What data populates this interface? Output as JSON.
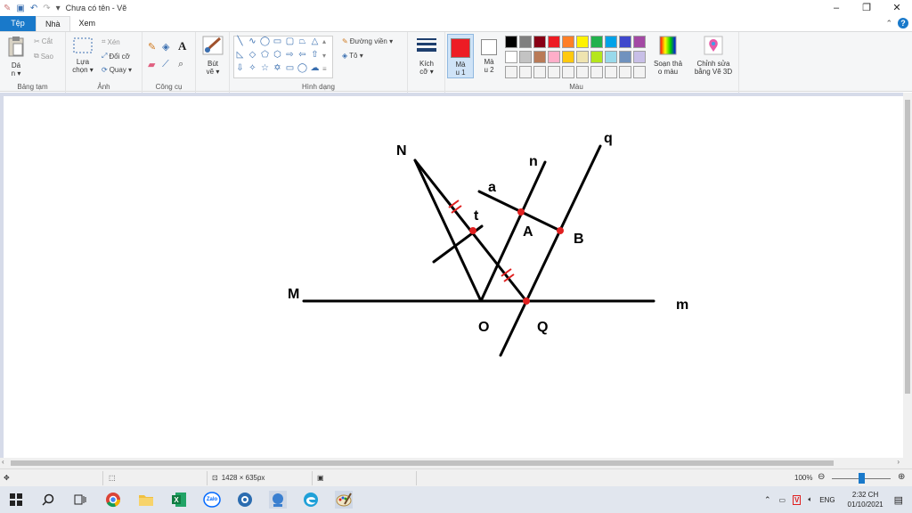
{
  "window": {
    "title": "Chưa có tên - Vẽ",
    "controls": {
      "minimize": "–",
      "maximize": "❐",
      "close": "✕"
    }
  },
  "tabs": {
    "file": "Tệp",
    "home": "Nhà",
    "view": "Xem",
    "help": "?"
  },
  "ribbon": {
    "clipboard": {
      "label": "Bảng tạm",
      "paste": "Dá",
      "paste2": "n ▾",
      "cut": "Cắt",
      "copy": "Sao"
    },
    "image": {
      "label": "Ảnh",
      "select": "Lựa",
      "select2": "chọn ▾",
      "crop": "Xén",
      "resize": "Đổi cỡ",
      "rotate": "Quay ▾"
    },
    "tools": {
      "label": "Công cụ",
      "text_glyph": "A"
    },
    "brushes": {
      "label": "Bút",
      "label2": "vẽ ▾"
    },
    "shapes": {
      "label": "Hình dạng",
      "outline": "Đường viền ▾",
      "fill": "Tô ▾"
    },
    "size": {
      "label": "Kích",
      "label2": "cỡ ▾"
    },
    "color1": {
      "label": "Mà",
      "label2": "u 1",
      "color": "#ed1c24"
    },
    "color2": {
      "label": "Mà",
      "label2": "u 2",
      "color": "#ffffff"
    },
    "colors": {
      "label": "Màu",
      "row1": [
        "#000000",
        "#7f7f7f",
        "#880015",
        "#ed1c24",
        "#ff7f27",
        "#fff200",
        "#22b14c",
        "#00a2e8",
        "#3f48cc",
        "#a349a4"
      ],
      "row2": [
        "#ffffff",
        "#c3c3c3",
        "#b97a57",
        "#ffaec9",
        "#ffc90e",
        "#efe4b0",
        "#b5e61d",
        "#99d9ea",
        "#7092be",
        "#c8bfe7"
      ],
      "row3": [
        "#f3f3f3",
        "#f3f3f3",
        "#f3f3f3",
        "#f3f3f3",
        "#f3f3f3",
        "#f3f3f3",
        "#f3f3f3",
        "#f3f3f3",
        "#f3f3f3",
        "#f3f3f3"
      ]
    },
    "edit_colors": {
      "label": "Soạn thả",
      "label2": "o màu"
    },
    "paint3d": {
      "label": "Chỉnh sửa",
      "label2": "bằng Vẽ 3D"
    }
  },
  "drawing": {
    "labels": {
      "N": "N",
      "n": "n",
      "q": "q",
      "a": "a",
      "t": "t",
      "A": "A",
      "B": "B",
      "M": "M",
      "m": "m",
      "O": "O",
      "Q": "Q"
    },
    "line_color": "#000000",
    "point_color": "#e02020"
  },
  "status": {
    "canvas_size": "1428 × 635px",
    "zoom": "100%"
  },
  "taskbar": {
    "icons": [
      "start-icon",
      "search-icon",
      "task-view-icon",
      "chrome-icon",
      "file-explorer-icon",
      "excel-icon",
      "zalo-icon",
      "app-icon",
      "network-icon",
      "edge-icon",
      "paint-icon"
    ],
    "zalo_label": "Zalo",
    "lang": "ENG",
    "time": "2:32 CH",
    "date": "01/10/2021"
  }
}
